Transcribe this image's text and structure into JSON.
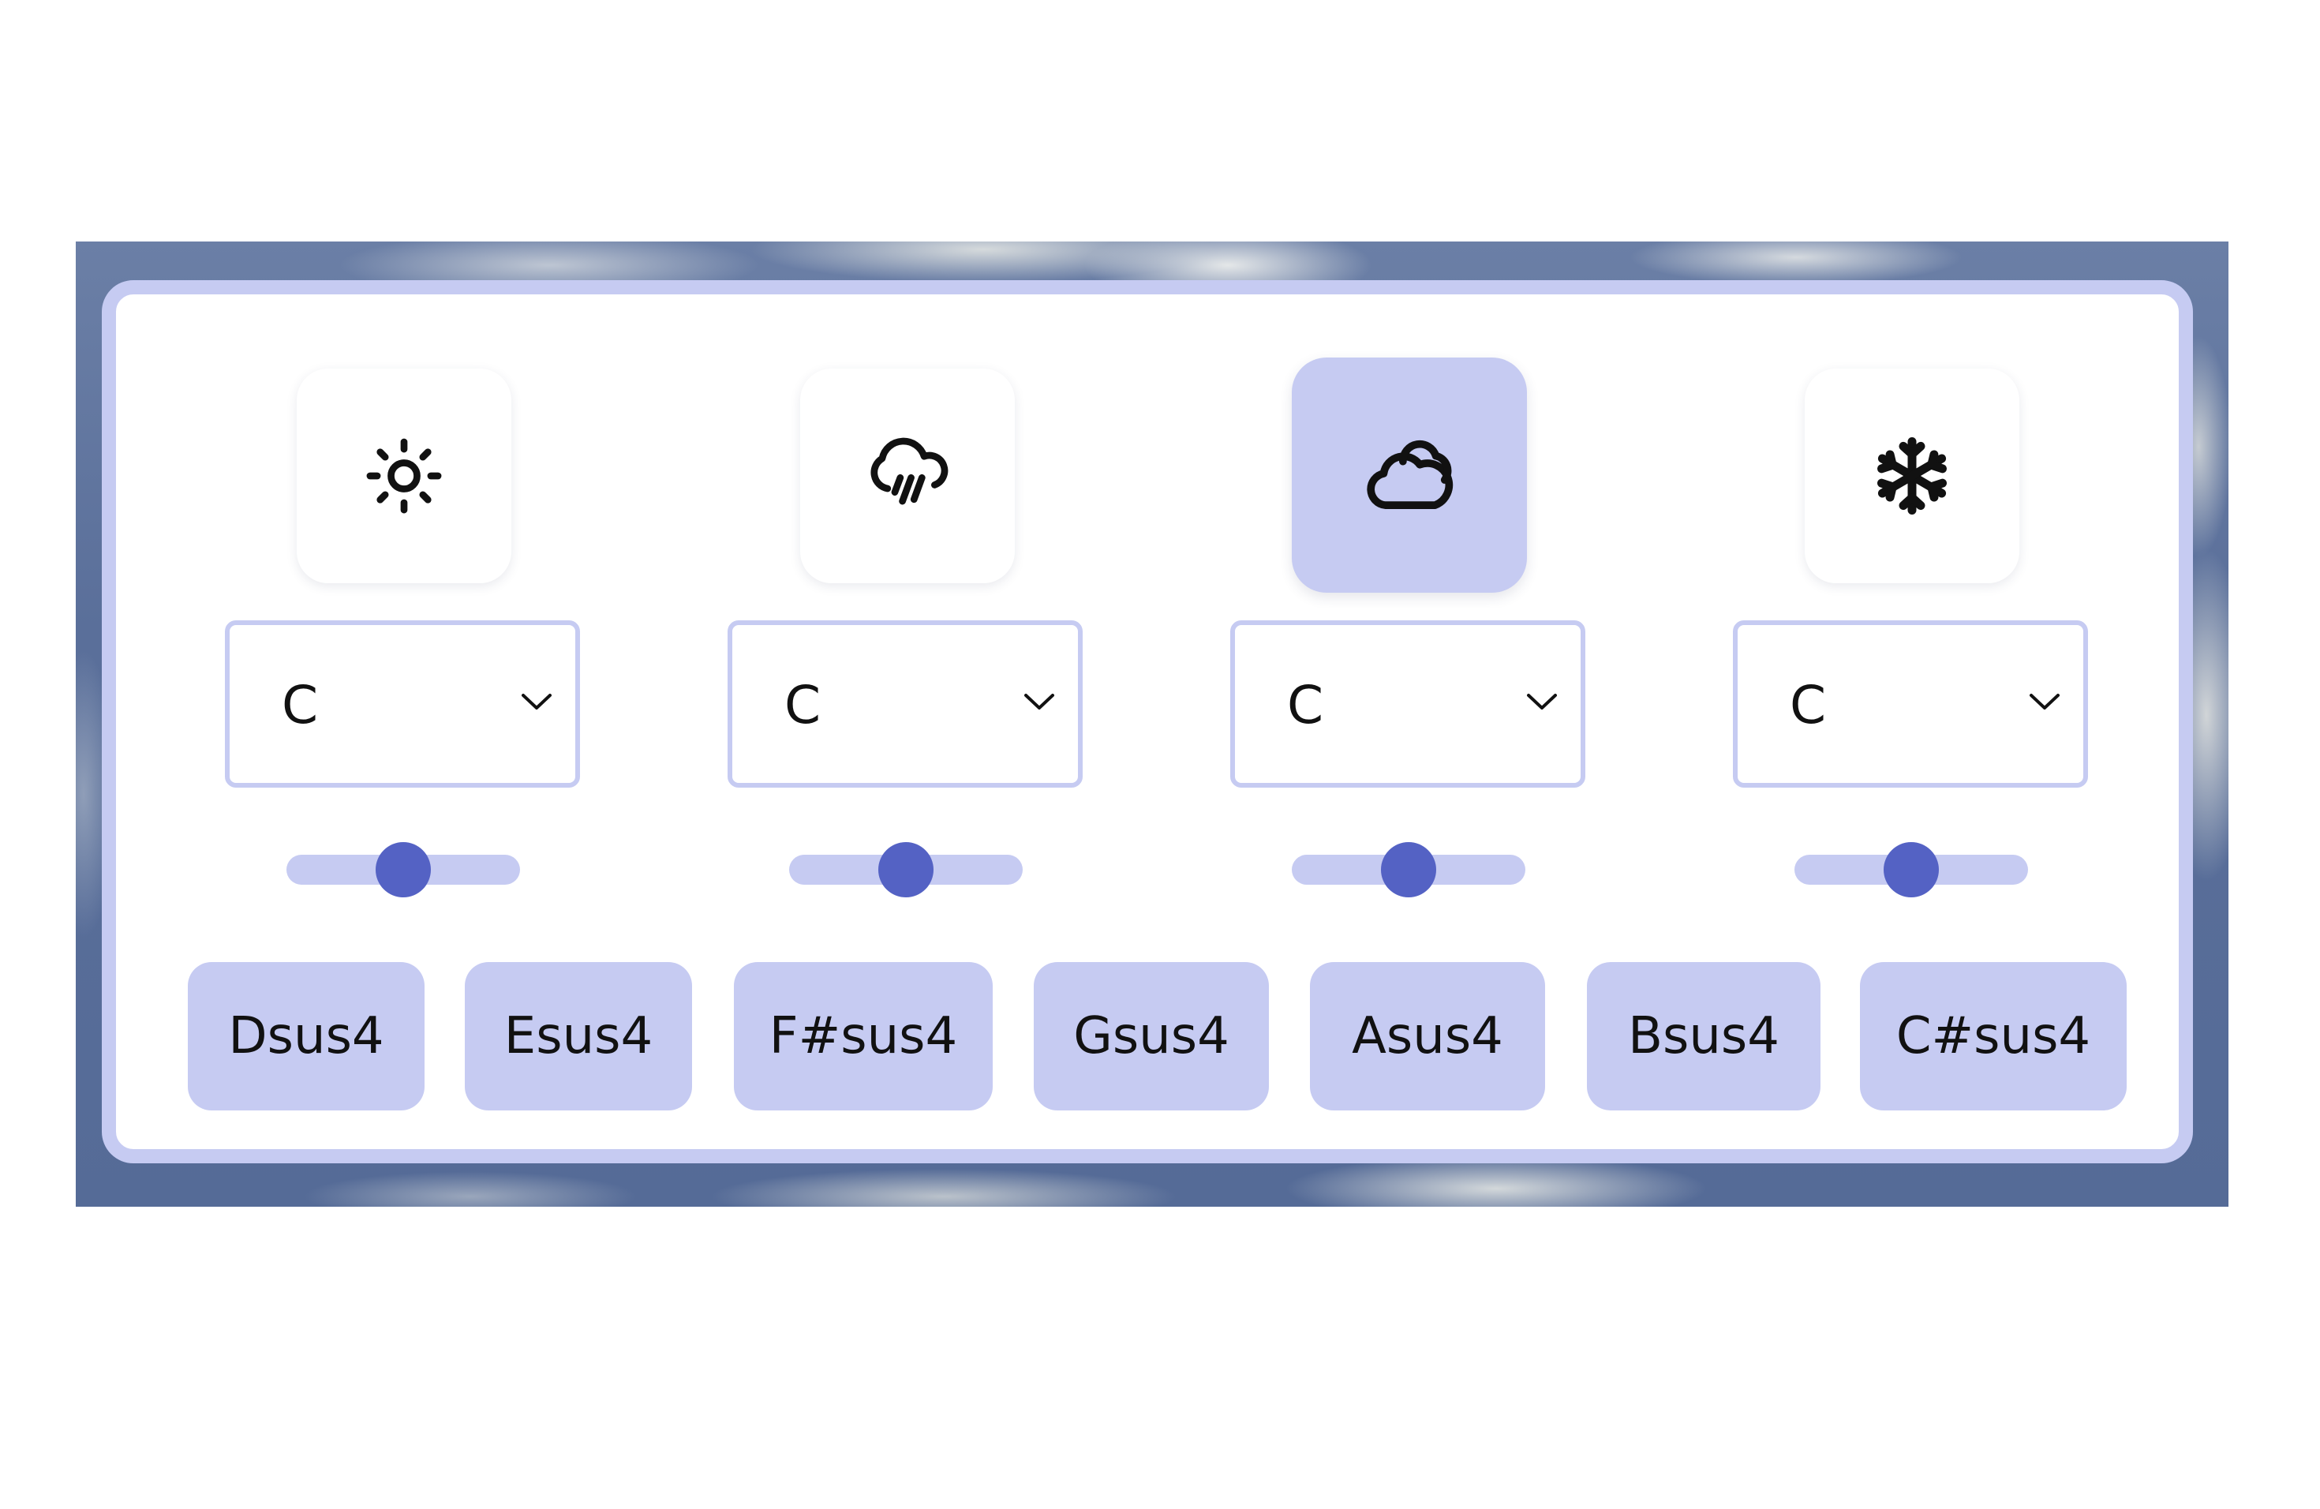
{
  "colors": {
    "accent_light": "#c6cbf2",
    "accent_dark": "#5462c4",
    "text": "#111111"
  },
  "weather_buttons": [
    {
      "icon": "sun-icon",
      "active": false
    },
    {
      "icon": "rain-cloud-icon",
      "active": false
    },
    {
      "icon": "cloud-icon",
      "active": true
    },
    {
      "icon": "snowflake-icon",
      "active": false
    }
  ],
  "selects": [
    {
      "value": "C"
    },
    {
      "value": "C"
    },
    {
      "value": "C"
    },
    {
      "value": "C"
    }
  ],
  "sliders": [
    {
      "value": 0.5
    },
    {
      "value": 0.5
    },
    {
      "value": 0.5
    },
    {
      "value": 0.5
    }
  ],
  "chords": [
    "Dsus4",
    "Esus4",
    "F#sus4",
    "Gsus4",
    "Asus4",
    "Bsus4",
    "C#sus4"
  ]
}
